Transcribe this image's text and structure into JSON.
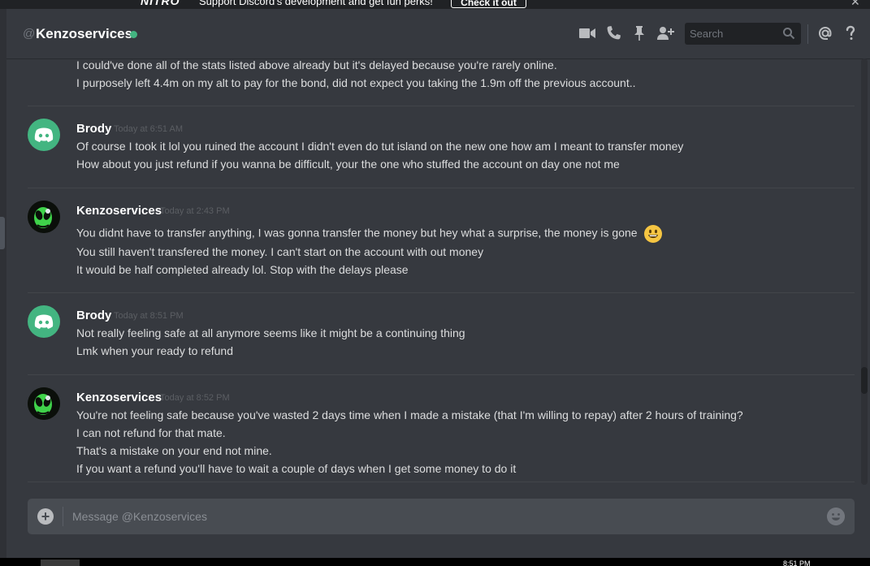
{
  "nitro_banner": {
    "logo": "NITRO",
    "text": "Support Discord's development and get fun perks!",
    "button": "Check it out"
  },
  "header": {
    "at_symbol": "@",
    "title": "Kenzoservices",
    "status": "online",
    "status_color": "#43b581",
    "icons": [
      "video-call-icon",
      "voice-call-icon",
      "pin-icon",
      "add-friend-icon",
      "mention-icon",
      "help-icon"
    ],
    "search_placeholder": "Search"
  },
  "messages": [
    {
      "continued": true,
      "lines": [
        "I could've done all of the stats listed above already but it's delayed because you're rarely online.",
        "I purposely left 4.4m on my alt to pay for the bond, did not expect you taking the 1.9m off the previous account.."
      ]
    },
    {
      "author": "Brody",
      "timestamp": "Today at 6:51 AM",
      "avatar": "discord-default-avatar",
      "lines": [
        "Of course I took it lol you ruined the account I didn't even do tut island on the new one how am I meant to transfer money",
        "How about you just refund if you wanna be difficult, your the one who stuffed the account on day one not me"
      ]
    },
    {
      "author": "Kenzoservices",
      "timestamp": "Today at 2:43 PM",
      "avatar": "alien-avatar",
      "lines": [
        "You didnt have to transfer anything, I was gonna transfer the money but hey what a surprise, the money is gone",
        "You still haven't transfered the money. I can't start on the account with out money",
        "It would be half completed already lol. Stop with the delays please"
      ]
    },
    {
      "author": "Brody",
      "timestamp": "Today at 8:51 PM",
      "avatar": "discord-default-avatar",
      "lines": [
        "Not really feeling safe at all anymore seems like it might be a continuing thing",
        "Lmk when your ready to refund"
      ]
    },
    {
      "author": "Kenzoservices",
      "timestamp": "Today at 8:52 PM",
      "avatar": "alien-avatar",
      "lines": [
        "You're not feeling safe because you've wasted 2 days time when I made a mistake (that I'm willing to repay) after 2 hours of training?",
        "I can not refund for that mate.",
        "That's a mistake on your end not mine.",
        "If you want a refund you'll have to wait a couple of days when I get some money to do it"
      ]
    }
  ],
  "composer": {
    "placeholder": "Message @Kenzoservices"
  },
  "taskbar": {
    "clock": "8:51 PM"
  },
  "colors": {
    "background": "#36393f",
    "text": "#dcddde",
    "username": "#ffffff",
    "timestamp": "#5b5e63",
    "discord_green_avatar": "#43b581",
    "emoji": "#f5c542"
  }
}
